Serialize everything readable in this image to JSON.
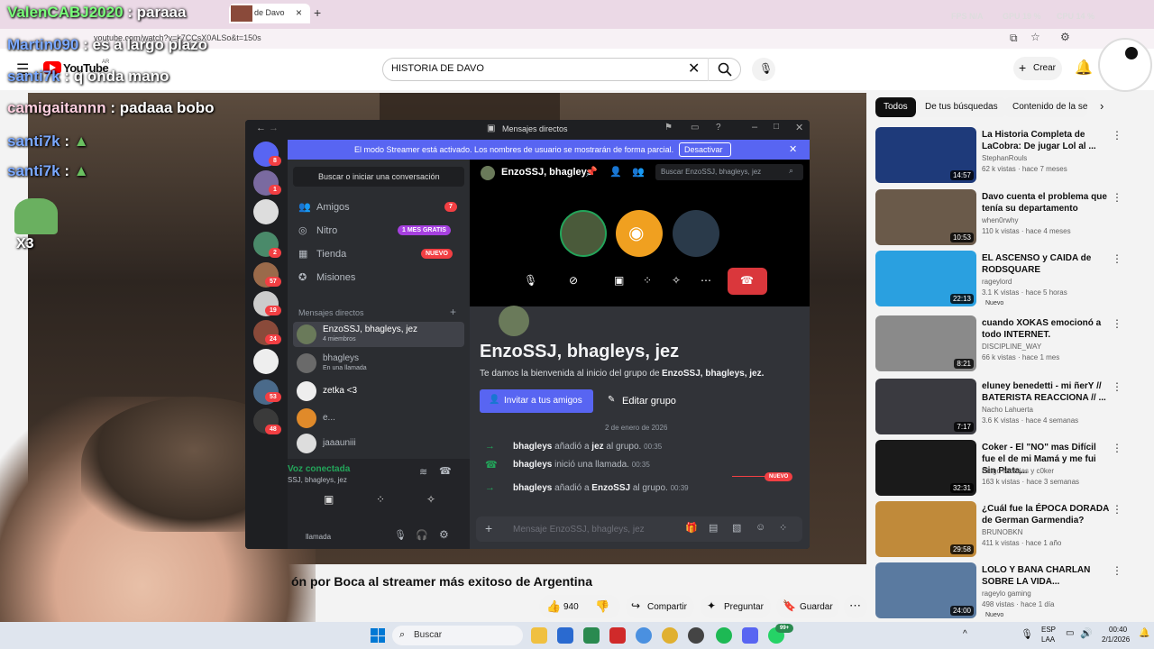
{
  "browser": {
    "tab_title": "de Davo",
    "new_tab": "+",
    "tab_close": "×",
    "url": "youtube.com/watch?v=k7CCsX0ALSo&t=150s",
    "overlay_stats": [
      "FPS N/A",
      "GPU 19 %",
      "CPU 14 %"
    ]
  },
  "youtube": {
    "logo": "YouTube",
    "logo_region": "AR",
    "search_value": "HISTORIA DE DAVO",
    "create_label": "Crear",
    "video_title": "ón por Boca al streamer más exitoso de Argentina",
    "likes": "940",
    "share_label": "Compartir",
    "ask_label": "Preguntar",
    "save_label": "Guardar",
    "chips": [
      "Todos",
      "De tus búsquedas",
      "Contenido de la ser"
    ],
    "recommendations": [
      {
        "title": "La Historia Completa de LaCobra: De jugar Lol al ...",
        "channel": "StephanRouls",
        "meta": "62 k vistas · hace 7 meses",
        "duration": "14:57",
        "thumb_color": "#1e3a7a"
      },
      {
        "title": "Davo cuenta el problema que tenía su departamento",
        "channel": "when0rwhy",
        "meta": "110 k vistas · hace 4 meses",
        "duration": "10:53",
        "thumb_color": "#6a5a4a"
      },
      {
        "title": "EL ASCENSO y CAIDA de RODSQUARE",
        "channel": "rageylord",
        "meta": "3.1 K vistas · hace 5 horas",
        "duration": "22:13",
        "thumb_color": "#2aa0e0",
        "badge": "Nuevo"
      },
      {
        "title": "cuando XOKAS emocionó a todo INTERNET.",
        "channel": "DISCIPLINE_WAY",
        "meta": "66 k vistas · hace 1 mes",
        "duration": "8:21",
        "thumb_color": "#8a8a8a"
      },
      {
        "title": "eluney benedetti - mi ñerY // BATERISTA REACCIONA // ...",
        "channel": "Nacho Lahuerta",
        "meta": "3.6 K vistas · hace 4 semanas",
        "duration": "7:17",
        "thumb_color": "#3a3a40"
      },
      {
        "title": "Coker - El \"NO\" mas Difícil fue el de mi Mamá y me fui Sin Plata...",
        "channel": "Diego Navajas y c0ker",
        "meta": "163 k vistas · hace 3 semanas",
        "duration": "32:31",
        "thumb_color": "#1a1a1a"
      },
      {
        "title": "¿Cuál fue la ÉPOCA DORADA de German Garmendia?",
        "channel": "BRUNOBKN",
        "meta": "411 k vistas · hace 1 año",
        "duration": "29:58",
        "thumb_color": "#c08a3a"
      },
      {
        "title": "LOLO Y BANA CHARLAN SOBRE LA VIDA...",
        "channel": "rageylo gaming",
        "meta": "498 vistas · hace 1 día",
        "duration": "24:00",
        "thumb_color": "#5a7aa0",
        "badge": "Nuevo"
      }
    ]
  },
  "chat_overlay": [
    {
      "user": "ValenCABJ2020",
      "msg": ": paraaa"
    },
    {
      "user": "Martin090",
      "msg": ": es a largo plazo"
    },
    {
      "user": "santi7k",
      "msg": ": q onda mano"
    },
    {
      "user": "camigaitannn",
      "msg": ": padaaa bobo"
    },
    {
      "user": "santi7k",
      "msg": ":"
    },
    {
      "user": "santi7k",
      "msg": ":"
    }
  ],
  "chat_overlay_badge": "X3",
  "discord": {
    "window_title": "Mensajes directos",
    "banner_text": "El modo Streamer está activado. Los nombres de usuario se mostrarán de forma parcial.",
    "banner_button": "Desactivar",
    "search_placeholder": "Buscar o iniciar una conversación",
    "nav": [
      {
        "label": "Amigos",
        "badge": "7"
      },
      {
        "label": "Nitro",
        "badge": "1 MES GRATIS"
      },
      {
        "label": "Tienda",
        "badge": "NUEVO"
      },
      {
        "label": "Misiones",
        "badge": ""
      }
    ],
    "dm_header": "Mensajes directos",
    "dms": [
      {
        "name": "EnzoSSJ, bhagleys, jez",
        "sub": "4 miembros"
      },
      {
        "name": "bhagleys",
        "sub": "En una llamada"
      },
      {
        "name": "zetka <3",
        "sub": ""
      },
      {
        "name": "e...",
        "sub": ""
      },
      {
        "name": "jaaauniii",
        "sub": ""
      }
    ],
    "voice_status": "Voz conectada",
    "voice_sub": "SSJ, bhagleys, jez",
    "call_sub": "llamada",
    "server_badges": [
      "8",
      "1",
      "2",
      "57",
      "19",
      "24",
      "53",
      "48"
    ],
    "group_name": "EnzoSSJ, bhagleys",
    "group_search": "Buscar EnzoSSJ, bhagleys, jez",
    "welcome_title": "EnzoSSJ, bhagleys, jez",
    "welcome_prefix": "Te damos la bienvenida al inicio del grupo de ",
    "welcome_bold": "EnzoSSJ, bhagleys, jez.",
    "invite_button": "Invitar a tus amigos",
    "edit_button": "Editar grupo",
    "date_divider": "2 de enero de 2026",
    "new_marker": "NUEVO",
    "system_messages": [
      {
        "actor": "bhagleys",
        "text1": " añadió a ",
        "target": "jez",
        "text2": " al grupo.",
        "time": "00:35"
      },
      {
        "actor": "bhagleys",
        "text1": " inició una llamada.",
        "target": "",
        "text2": "",
        "time": "00:35"
      },
      {
        "actor": "bhagleys",
        "text1": " añadió a ",
        "target": "EnzoSSJ",
        "text2": " al grupo.",
        "time": "00:39"
      }
    ],
    "message_placeholder": "Mensaje EnzoSSJ, bhagleys, jez"
  },
  "taskbar": {
    "search_label": "Buscar",
    "lang": "ESP",
    "lang_sub": "LAA",
    "time": "00:40",
    "date": "2/1/2026",
    "notif_count": "99+"
  }
}
